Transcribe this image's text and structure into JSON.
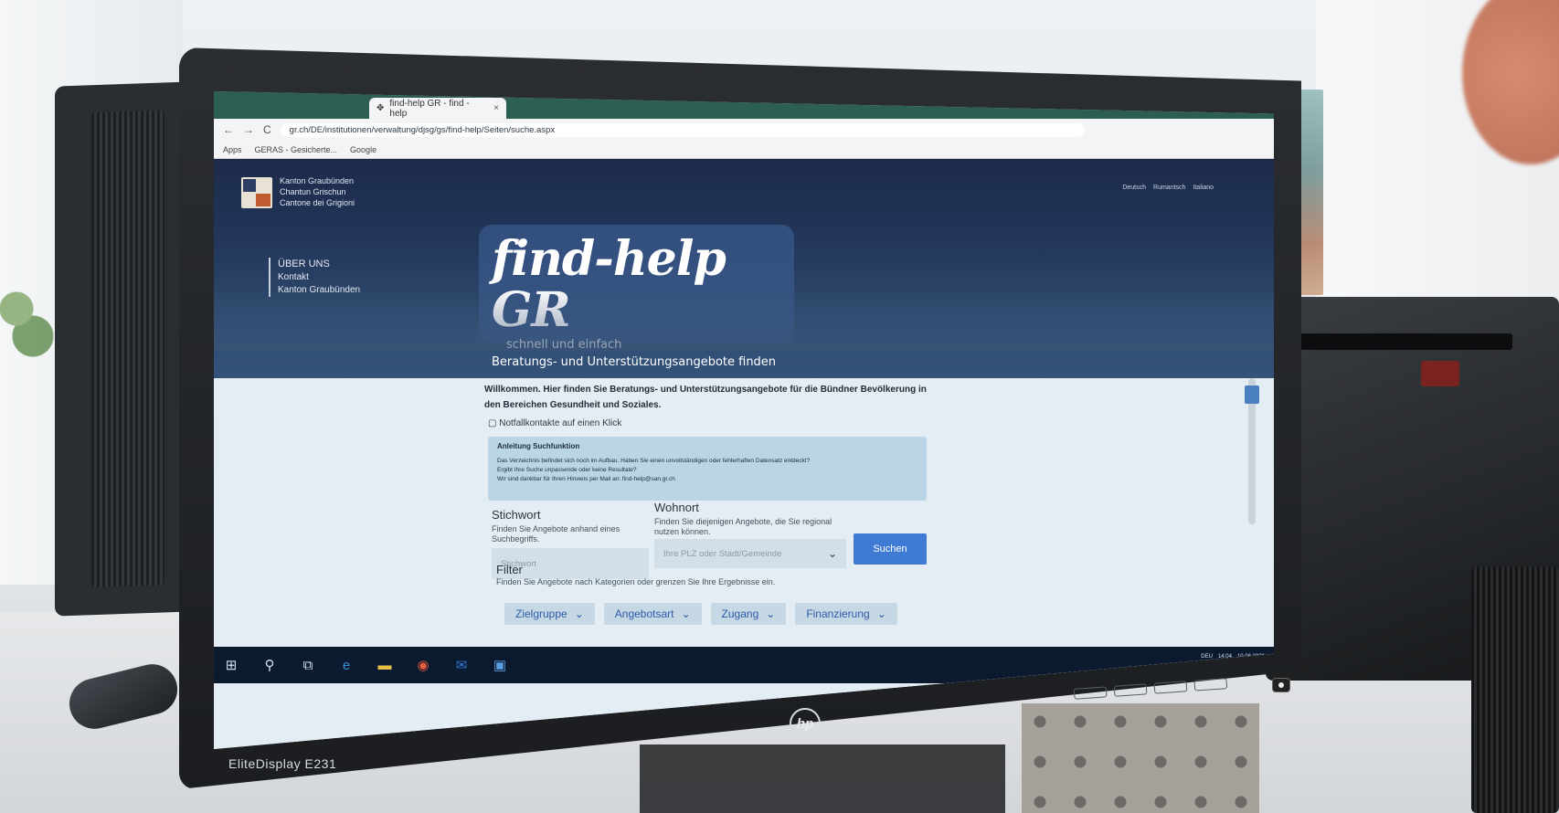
{
  "browser": {
    "tab_inactive_label": "",
    "tab_active_label": "find-help GR - find - help",
    "tab_close": "×",
    "nav_back": "←",
    "nav_forward": "→",
    "nav_reload": "C",
    "url": "gr.ch/DE/institutionen/verwaltung/djsg/gs/find-help/Seiten/suche.aspx",
    "bookmarks": [
      "Apps",
      "GERAS - Gesicherte...",
      "Google"
    ]
  },
  "site": {
    "canton_lines": [
      "Kanton Graubünden",
      "Chantun Grischun",
      "Cantone dei Grigioni"
    ],
    "languages": [
      "Deutsch",
      "Rumantsch",
      "Italiano"
    ],
    "nav": [
      "ÜBER UNS",
      "Kontakt",
      "Kanton Graubünden"
    ],
    "hero_title": "find-help GR",
    "hero_sub1": "schnell und einfach",
    "hero_sub2": "Beratungs- und Unterstützungsangebote finden"
  },
  "main": {
    "welcome": "Willkommen. Hier finden Sie Beratungs- und Unterstützungsangebote für die Bündner Bevölkerung in den Bereichen Gesundheit und Soziales.",
    "emergency": "Notfallkontakte auf einen Klick",
    "info_title": "Anleitung Suchfunktion",
    "info_line1": "Das Verzeichnis befindet sich noch im Aufbau. Haben Sie einen unvollständigen oder fehlerhaften Datensatz entdeckt?",
    "info_line2": "Ergibt Ihre Suche unpassende oder keine Resultate?",
    "info_line3": "Wir sind dankbar für Ihren Hinweis per Mail an: find-help@san.gr.ch",
    "stichwort_label": "Stichwort",
    "stichwort_help": "Finden Sie Angebote anhand eines Suchbegriffs.",
    "stichwort_placeholder": "Stichwort",
    "wohnort_label": "Wohnort",
    "wohnort_help": "Finden Sie diejenigen Angebote, die Sie regional nutzen können.",
    "wohnort_placeholder": "Ihre PLZ oder Stadt/Gemeinde",
    "search_button": "Suchen",
    "filter_label": "Filter",
    "filter_help": "Finden Sie Angebote nach Kategorien oder grenzen Sie Ihre Ergebnisse ein.",
    "filters": [
      "Zielgruppe",
      "Angebotsart",
      "Zugang",
      "Finanzierung"
    ]
  },
  "monitor": {
    "model": "EliteDisplay E231",
    "brand": "hp"
  },
  "taskbar": {
    "tray_time": "14:04",
    "tray_date": "10.06.2021",
    "tray_lang": "DEU"
  }
}
